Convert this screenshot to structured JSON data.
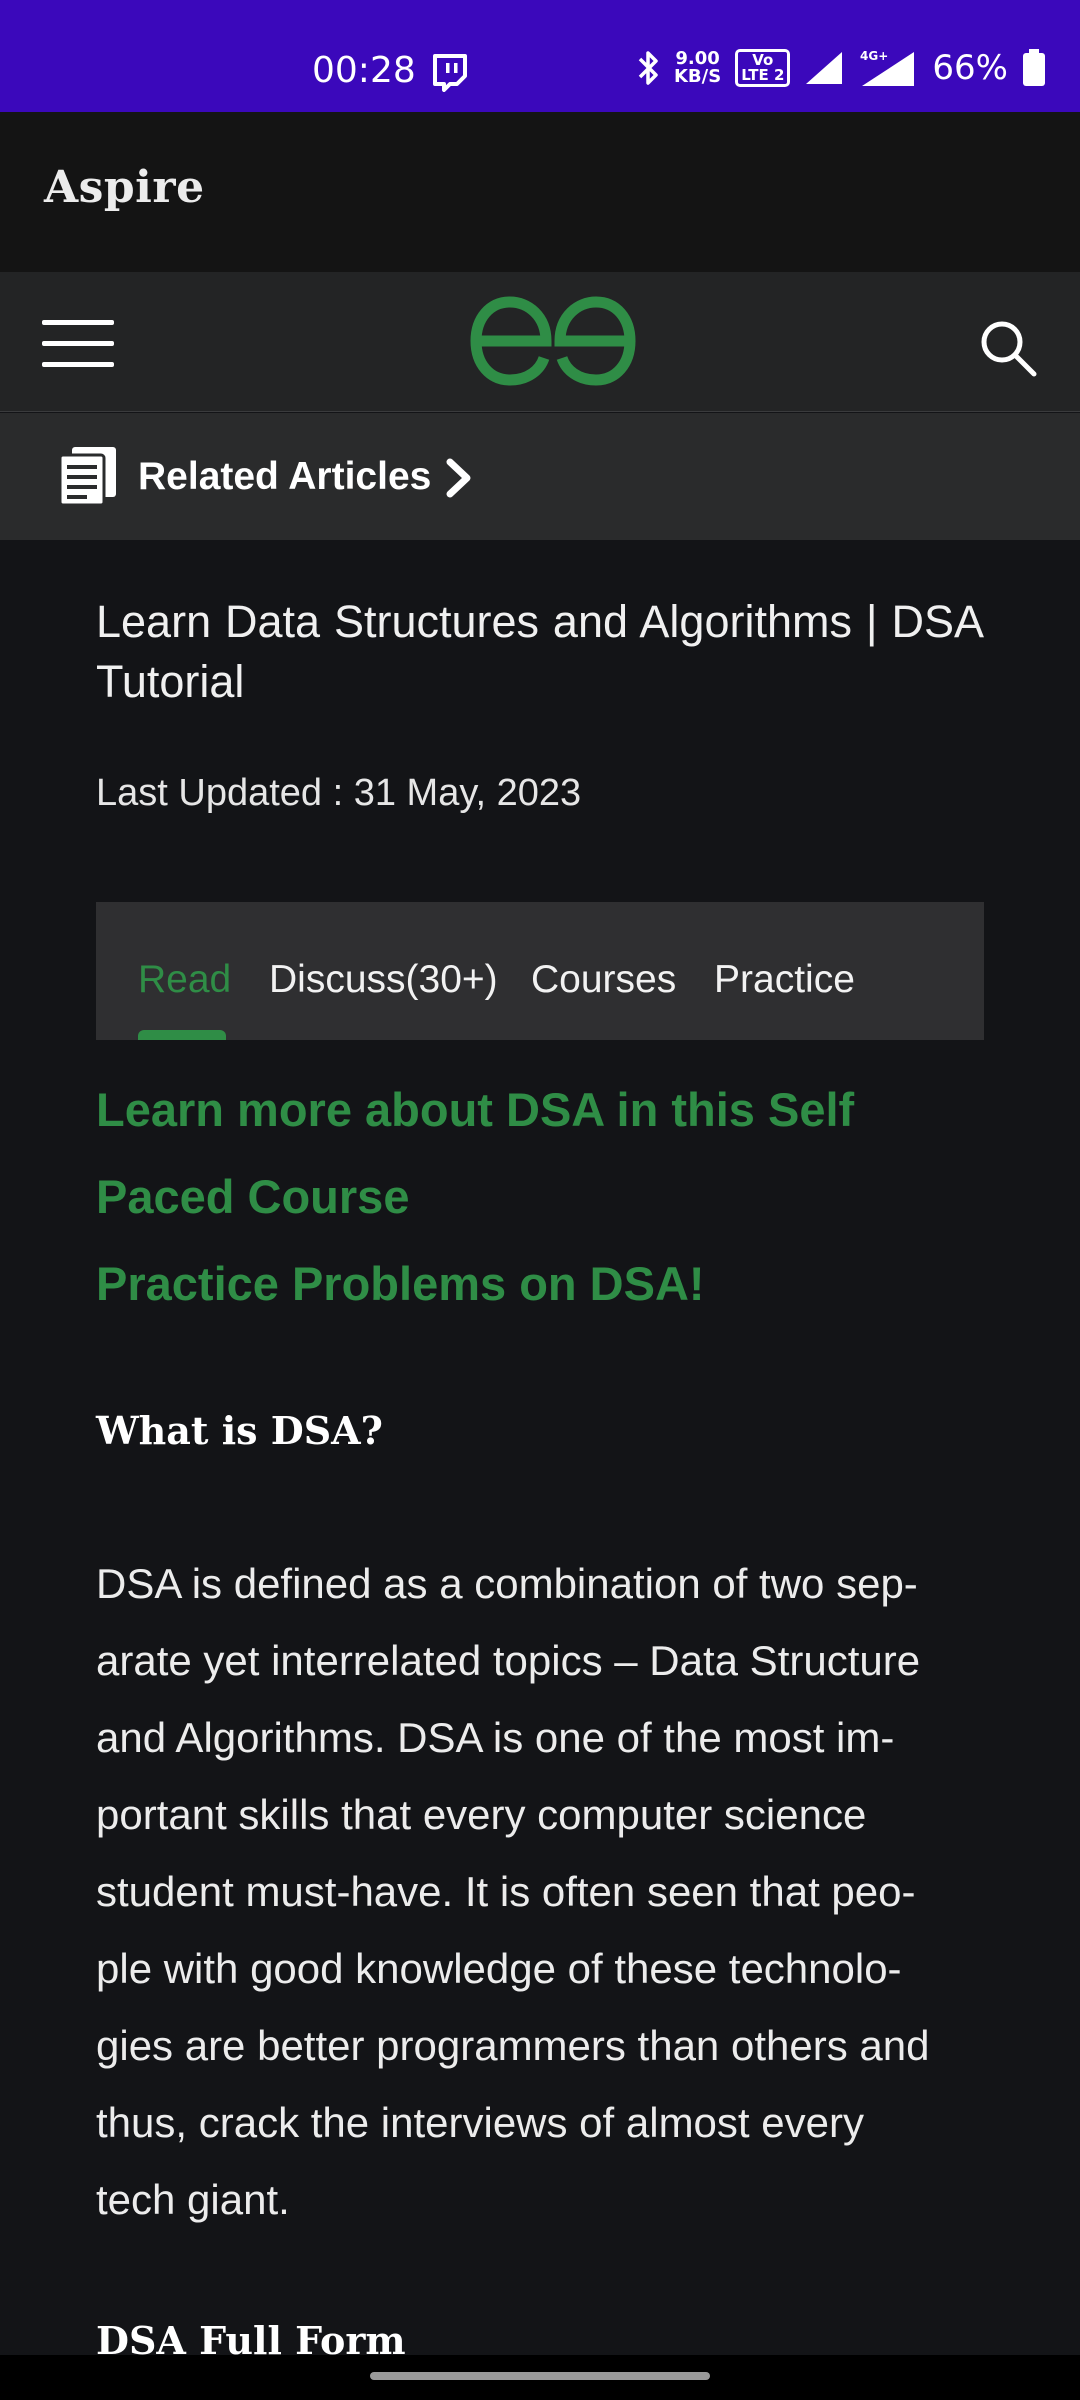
{
  "status_bar": {
    "time": "00:28",
    "speed_value": "9.00",
    "speed_unit": "KB/S",
    "volte_top": "Vo",
    "volte_bottom": "LTE 2",
    "network": "4G+",
    "battery": "66%"
  },
  "app": {
    "name": "Aspire"
  },
  "header": {
    "logo": "gfg-logo",
    "menu_icon": "hamburger-icon",
    "search_icon": "search-icon"
  },
  "related": {
    "label": "Related Articles"
  },
  "article": {
    "title": "Learn Data Structures and Algorithms | DSA Tutorial",
    "updated": "Last Updated : 31 May, 2023",
    "tabs": [
      {
        "label": "Read",
        "active": true
      },
      {
        "label": "Discuss(30+)",
        "active": false
      },
      {
        "label": "Courses",
        "active": false
      },
      {
        "label": "Practice",
        "active": false
      }
    ],
    "promo_links": [
      "Learn more about DSA in this Self",
      "Paced Course",
      "Practice Problems on DSA!"
    ],
    "section1_heading": "What is DSA?",
    "paragraph_lines": [
      "DSA is defined as a combination of two sep-",
      "arate yet interrelated topics – Data Structure",
      "and Algorithms. DSA is one of the most im-",
      "portant skills that every computer science",
      "student must-have. It is often seen that peo-",
      "ple with good knowledge of these technolo-",
      "gies are better programmers than others and",
      "thus, crack the interviews of almost every",
      "tech giant."
    ],
    "section2_heading": "DSA Full Form"
  },
  "colors": {
    "accent": "#2f8d46",
    "status_bar": "#3b08bb",
    "background": "#131417"
  }
}
